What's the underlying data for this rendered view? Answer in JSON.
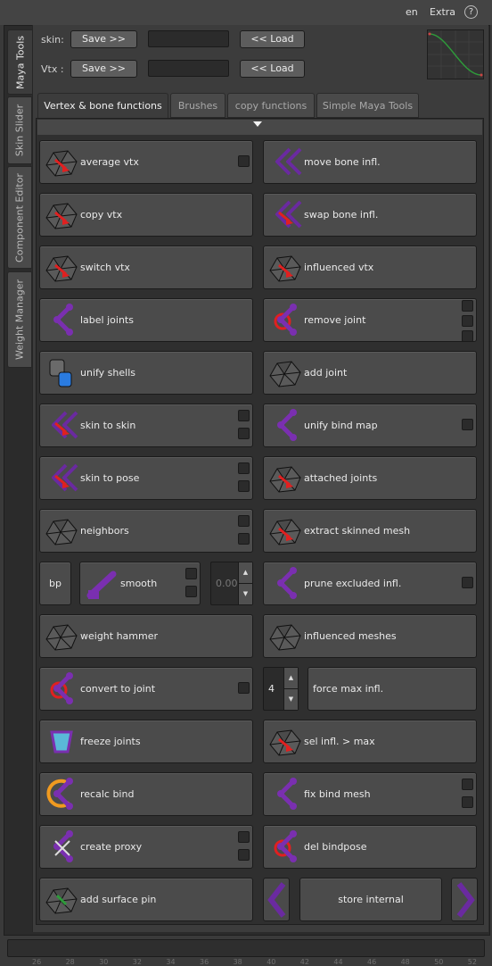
{
  "menu": {
    "lang": "en",
    "extra": "Extra",
    "help": "?"
  },
  "side_tabs": [
    "Maya Tools",
    "Skin Slider",
    "Component Editor",
    "Weight Manager"
  ],
  "skin_row": {
    "label": "skin:",
    "save": "Save >>",
    "load": "<< Load"
  },
  "vtx_row": {
    "label": "Vtx :",
    "save": "Save >>",
    "load": "<< Load"
  },
  "tabs": [
    "Vertex & bone functions",
    "Brushes",
    "copy functions",
    "Simple Maya Tools"
  ],
  "left_buttons": [
    "average vtx",
    "copy vtx",
    "switch vtx",
    "label joints",
    "unify shells",
    "skin to skin",
    "skin to pose",
    "neighbors",
    "smooth",
    "weight hammer",
    "convert to joint",
    "freeze joints",
    "recalc bind",
    "create proxy",
    "add surface pin"
  ],
  "right_buttons": [
    "move bone infl.",
    "swap bone infl.",
    "influenced vtx",
    "remove joint",
    "add joint",
    "unify bind map",
    "attached joints",
    "extract skinned mesh",
    "prune excluded infl.",
    "influenced meshes",
    "force max infl.",
    "sel infl. > max",
    "fix bind mesh",
    "del bindpose",
    "store internal"
  ],
  "bp_button": "bp",
  "smooth_value": "0.00",
  "force_max_value": "4",
  "ruler": [
    "26",
    "28",
    "30",
    "32",
    "34",
    "36",
    "38",
    "40",
    "42",
    "44",
    "46",
    "48",
    "50",
    "52"
  ],
  "icons": {
    "average": "average-vertex-icon",
    "copy": "copy-vertex-icon",
    "switch": "switch-vertex-icon"
  },
  "colors": {
    "accent": "#7a2fb0",
    "highlight": "#e02020",
    "panel": "#3c3c3c"
  }
}
